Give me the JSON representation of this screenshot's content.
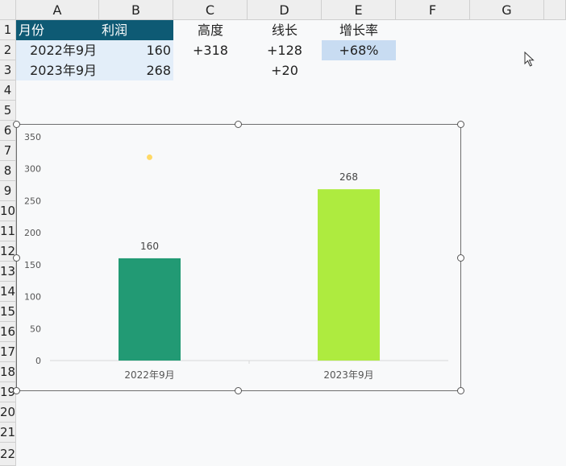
{
  "columns": [
    "A",
    "B",
    "C",
    "D",
    "E",
    "F",
    "G"
  ],
  "rows": [
    "1",
    "2",
    "3",
    "4",
    "5",
    "6",
    "7",
    "8",
    "9",
    "10",
    "11",
    "12",
    "13",
    "14",
    "15",
    "16",
    "17",
    "18",
    "19",
    "20",
    "21",
    "22"
  ],
  "table": {
    "headers": [
      "月份",
      "利润"
    ],
    "rows": [
      {
        "month": "2022年9月",
        "profit": "160"
      },
      {
        "month": "2023年9月",
        "profit": "268"
      }
    ]
  },
  "calc": {
    "height_label": "高度",
    "height_value": "+318",
    "line_label": "线长",
    "line_value1": "+128",
    "line_value2": "+20",
    "growth_label": "增长率",
    "growth_value": "+68%"
  },
  "chart_data": {
    "type": "bar",
    "categories": [
      "2022年9月",
      "2023年9月"
    ],
    "values": [
      160,
      268
    ],
    "data_labels": [
      "160",
      "268"
    ],
    "bar_colors": [
      "#229a74",
      "#aeeb3f"
    ],
    "ylim": [
      0,
      350
    ],
    "yticks": [
      0,
      50,
      100,
      150,
      200,
      250,
      300,
      350
    ],
    "marker_point": {
      "y": 318,
      "color": "#ffd966"
    },
    "grid": false
  },
  "colors": {
    "header_fill": "#0e5a74",
    "band_fill": "#e3eef9",
    "selected_fill": "#c8dcf2"
  },
  "icons": {
    "cursor": "mouse-pointer-icon"
  }
}
